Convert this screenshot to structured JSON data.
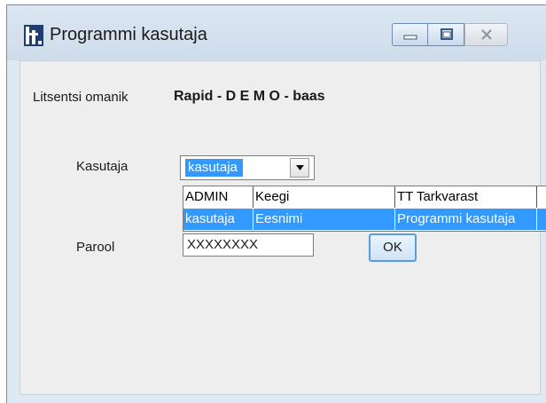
{
  "window": {
    "title": "Programmi kasutaja"
  },
  "license": {
    "label": "Litsentsi omanik",
    "value": "Rapid - D E M O - baas"
  },
  "user": {
    "label": "Kasutaja",
    "selected": "kasutaja"
  },
  "dropdown": {
    "rows": [
      {
        "cells": [
          "ADMIN",
          "Keegi",
          "TT Tarkvarast"
        ]
      },
      {
        "cells": [
          "kasutaja",
          "Eesnimi",
          "Programmi kasutaja"
        ]
      }
    ]
  },
  "password": {
    "label": "Parool",
    "value": "XXXXXXXX"
  },
  "ok": {
    "label": "OK"
  },
  "icons": {
    "app": "app-logo-icon",
    "minimize": "minimize-icon",
    "maximize": "maximize-icon",
    "close": "close-icon",
    "dropdown": "chevron-down-icon"
  },
  "colors": {
    "selection": "#3399ff",
    "title_bar": "#dbe6f2"
  }
}
